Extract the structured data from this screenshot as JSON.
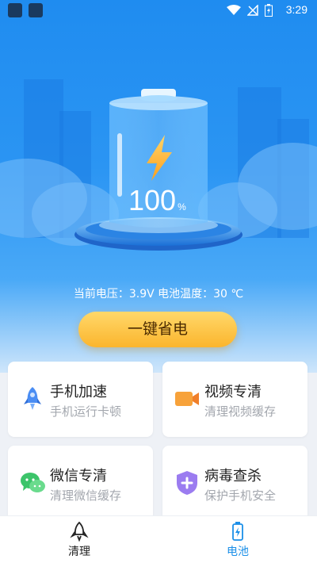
{
  "status_bar": {
    "time": "3:29"
  },
  "battery": {
    "percent": "100",
    "percent_unit": "%"
  },
  "info": {
    "voltage_label": "当前电压：",
    "voltage": "3.9V",
    "temp_label": "电池温度：",
    "temp": "30 ℃"
  },
  "cta": {
    "label": "一键省电"
  },
  "cards": [
    {
      "title": "手机加速",
      "subtitle": "手机运行卡顿",
      "icon": "rocket-icon"
    },
    {
      "title": "视频专清",
      "subtitle": "清理视频缓存",
      "icon": "video-camera-icon"
    },
    {
      "title": "微信专清",
      "subtitle": "清理微信缓存",
      "icon": "wechat-icon"
    },
    {
      "title": "病毒查杀",
      "subtitle": "保护手机安全",
      "icon": "shield-icon"
    }
  ],
  "nav": {
    "items": [
      {
        "label": "清理",
        "icon": "rocket-outline-icon",
        "active": false
      },
      {
        "label": "电池",
        "icon": "battery-icon",
        "active": true
      }
    ]
  },
  "colors": {
    "primary": "#1f8cf0",
    "active_nav": "#1b8fe8",
    "cta": "#fbb52d"
  }
}
